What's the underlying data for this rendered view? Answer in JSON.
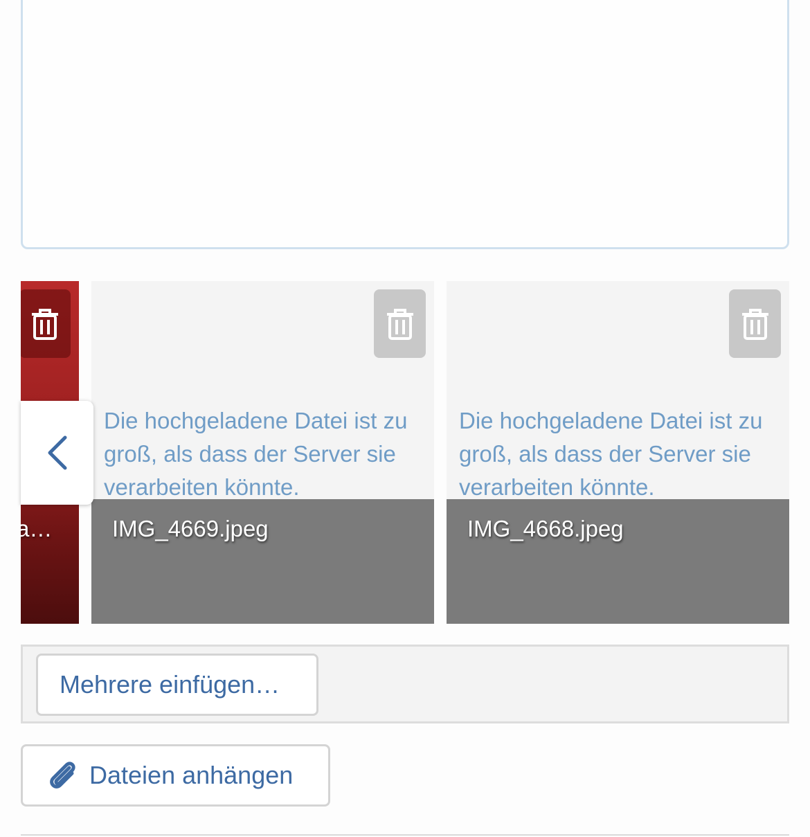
{
  "attachments": {
    "partial_name": "a…",
    "items": [
      {
        "error": "Die hochgeladene Datei ist zu groß, als dass der Server sie verarbeiten könnte.",
        "name": "IMG_4669.jpeg"
      },
      {
        "error": "Die hochgeladene Datei ist zu groß, als dass der Server sie verarbeiten könnte.",
        "name": "IMG_4668.jpeg"
      }
    ]
  },
  "toolbar": {
    "insert_multiple_label": "Mehrere einfügen…"
  },
  "attach": {
    "label": "Dateien anhängen"
  },
  "icons": {
    "delete": "trash-icon",
    "previous": "chevron-left-icon",
    "attach": "paperclip-icon"
  },
  "colors": {
    "link_blue": "#3d6aa3",
    "error_text": "#6f9cc6",
    "name_band": "#7b7b7b"
  }
}
